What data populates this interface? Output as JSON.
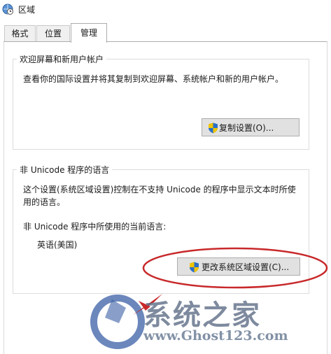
{
  "window": {
    "title": "区域",
    "icon": "globe-clock-icon"
  },
  "tabs": [
    {
      "label": "格式",
      "active": false
    },
    {
      "label": "位置",
      "active": false
    },
    {
      "label": "管理",
      "active": true
    }
  ],
  "welcome_group": {
    "title": "欢迎屏幕和新用户帐户",
    "description": "查看你的国际设置并将其复制到欢迎屏幕、系统帐户和新的用户帐户。",
    "copy_button": "复制设置(O)..."
  },
  "unicode_group": {
    "title": "非 Unicode 程序的语言",
    "description": "这个设置(系统区域设置)控制在不支持 Unicode 的程序中显示文本时所使用的语言。",
    "current_label": "非 Unicode 程序中所使用的当前语言:",
    "current_value": "英语(美国)",
    "change_button": "更改系统区域设置(C)..."
  },
  "annotation": {
    "color": "#c8282a"
  },
  "watermark": {
    "text": "系统之家",
    "url": "www.Ghost123.com",
    "icon": "ghost-logo-icon"
  },
  "colors": {
    "accent": "#c8282a",
    "watermark": "#5f6e87",
    "shield_blue": "#2a6fc9",
    "shield_yellow": "#f2c500"
  }
}
